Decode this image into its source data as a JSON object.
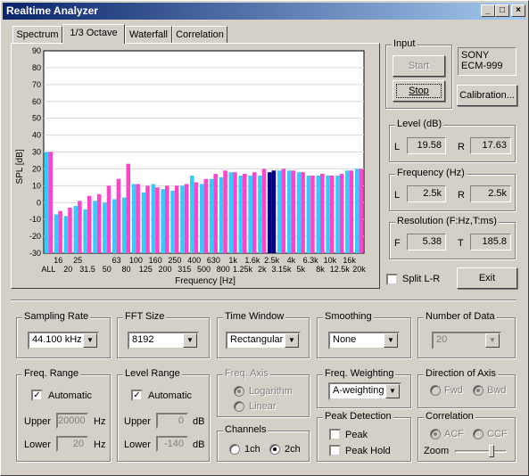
{
  "window": {
    "title": "Realtime Analyzer",
    "min_glyph": "_",
    "max_glyph": "□",
    "close_glyph": "×"
  },
  "tabs": [
    {
      "label": "Spectrum",
      "active": false
    },
    {
      "label": "1/3 Octave",
      "active": true
    },
    {
      "label": "Waterfall",
      "active": false
    },
    {
      "label": "Correlation",
      "active": false
    }
  ],
  "chart_data": {
    "type": "bar",
    "ylabel": "SPL [dB]",
    "xlabel": "Frequency [Hz]",
    "ylim": [
      -30,
      90
    ],
    "yticks": [
      -30,
      -20,
      -10,
      0,
      10,
      20,
      30,
      40,
      50,
      60,
      70,
      80,
      90
    ],
    "categories": [
      "ALL",
      "16",
      "20",
      "25",
      "31.5",
      "40",
      "50",
      "63",
      "80",
      "100",
      "125",
      "160",
      "200",
      "250",
      "315",
      "400",
      "500",
      "630",
      "800",
      "1k",
      "1.25k",
      "1.6k",
      "2k",
      "2.5k",
      "3.15k",
      "4k",
      "5k",
      "6.3k",
      "8k",
      "10k",
      "12.5k",
      "16k",
      "20k"
    ],
    "x_tick_row1": [
      "16",
      "25",
      "63",
      "100",
      "160",
      "250",
      "400",
      "630",
      "1k",
      "1.6k",
      "2.5k",
      "4k",
      "6.3k",
      "10k",
      "16k"
    ],
    "x_tick_row2": [
      "ALL",
      "20",
      "31.5",
      "50",
      "80",
      "125",
      "200",
      "315",
      "500",
      "800",
      "1.25k",
      "2k",
      "3.15k",
      "5k",
      "8k",
      "12.5k",
      "20k"
    ],
    "series": [
      {
        "name": "L",
        "color": "#33ccff",
        "values": [
          30,
          -7,
          -8,
          -2,
          -4,
          1,
          0,
          2,
          3,
          11,
          6,
          11,
          8,
          7,
          10,
          16,
          11,
          14,
          15,
          18,
          16,
          16,
          16,
          18,
          19,
          19,
          18,
          16,
          16,
          16,
          16,
          19,
          20
        ]
      },
      {
        "name": "R",
        "color": "#ff44cc",
        "values": [
          30,
          -5,
          -3,
          1,
          4,
          5,
          10,
          14,
          23,
          11,
          10,
          9,
          10,
          10,
          11,
          12,
          14,
          17,
          19,
          18,
          17,
          18,
          20,
          19,
          20,
          19,
          18,
          16,
          17,
          16,
          17,
          19,
          20
        ]
      }
    ],
    "marker": {
      "category": "2.5k",
      "color": "#000080"
    },
    "grid": true
  },
  "input": {
    "label": "Input",
    "start_label": "Start",
    "stop_label": "Stop",
    "device_line1": "SONY",
    "device_line2": "ECM-999",
    "calibration_label": "Calibration..."
  },
  "level": {
    "label": "Level (dB)",
    "l_label": "L",
    "l_value": "19.58",
    "r_label": "R",
    "r_value": "17.63"
  },
  "frequency": {
    "label": "Frequency (Hz)",
    "l_label": "L",
    "l_value": "2.5k",
    "r_label": "R",
    "r_value": "2.5k"
  },
  "resolution": {
    "label": "Resolution (F:Hz,T:ms)",
    "f_label": "F",
    "f_value": "5.38",
    "t_label": "T",
    "t_value": "185.8"
  },
  "split_lr": {
    "label": "Split L-R",
    "checked": false
  },
  "exit_label": "Exit",
  "sampling_rate": {
    "label": "Sampling Rate",
    "value": "44.100 kHz"
  },
  "fft_size": {
    "label": "FFT Size",
    "value": "8192"
  },
  "time_window": {
    "label": "Time Window",
    "value": "Rectangular"
  },
  "smoothing": {
    "label": "Smoothing",
    "value": "None"
  },
  "number_of_data": {
    "label": "Number of Data",
    "value": "20"
  },
  "freq_range": {
    "label": "Freq. Range",
    "auto_label": "Automatic",
    "upper_label": "Upper",
    "upper_value": "20000",
    "upper_unit": "Hz",
    "lower_label": "Lower",
    "lower_value": "20",
    "lower_unit": "Hz"
  },
  "level_range": {
    "label": "Level Range",
    "auto_label": "Automatic",
    "upper_label": "Upper",
    "upper_value": "0",
    "upper_unit": "dB",
    "lower_label": "Lower",
    "lower_value": "-140",
    "lower_unit": "dB"
  },
  "freq_axis": {
    "label": "Freq. Axis",
    "opt1": "Logarithm",
    "opt2": "Linear"
  },
  "channels": {
    "label": "Channels",
    "opt1": "1ch",
    "opt2": "2ch"
  },
  "freq_weighting": {
    "label": "Freq. Weighting",
    "value": "A-weighting"
  },
  "peak_detection": {
    "label": "Peak Detection",
    "opt1": "Peak",
    "opt2": "Peak Hold"
  },
  "direction_of_axis": {
    "label": "Direction of Axis",
    "opt1": "Fwd",
    "opt2": "Bwd"
  },
  "correlation": {
    "label": "Correlation",
    "opt1": "ACF",
    "opt2": "CCF",
    "zoom_label": "Zoom"
  }
}
